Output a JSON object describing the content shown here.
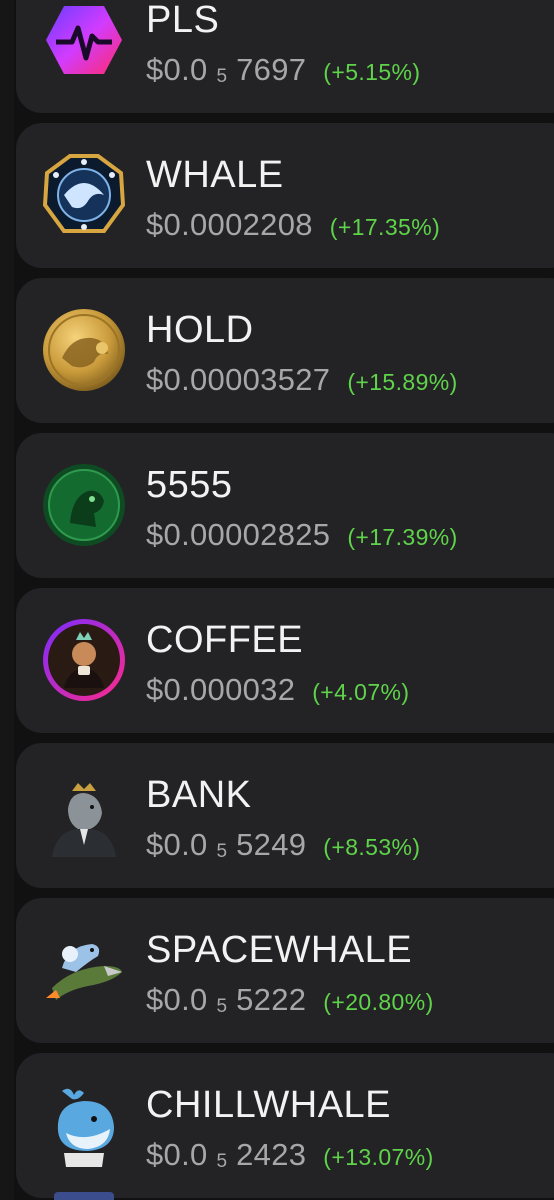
{
  "tokens": [
    {
      "symbol": "PLS",
      "price_prefix": "$0.0",
      "price_zeros": "5",
      "price_digits": "7697",
      "change": "(+5.15%)",
      "logo": "pulse-heartbeat-icon"
    },
    {
      "symbol": "WHALE",
      "price": "$0.0002208",
      "change": "(+17.35%)",
      "logo": "whale-octagon-icon"
    },
    {
      "symbol": "HOLD",
      "price": "$0.00003527",
      "change": "(+15.89%)",
      "logo": "gold-coin-icon"
    },
    {
      "symbol": "5555",
      "price": "$0.00002825",
      "change": "(+17.39%)",
      "logo": "green-coin-icon"
    },
    {
      "symbol": "COFFEE",
      "price": "$0.000032",
      "change": "(+4.07%)",
      "logo": "coffee-avatar-icon"
    },
    {
      "symbol": "BANK",
      "price_prefix": "$0.0",
      "price_zeros": "5",
      "price_digits": "5249",
      "change": "(+8.53%)",
      "logo": "banker-whale-icon"
    },
    {
      "symbol": "SPACEWHALE",
      "price_prefix": "$0.0",
      "price_zeros": "5",
      "price_digits": "5222",
      "change": "(+20.80%)",
      "logo": "rocket-whale-icon"
    },
    {
      "symbol": "CHILLWHALE",
      "price_prefix": "$0.0",
      "price_zeros": "5",
      "price_digits": "2423",
      "change": "(+13.07%)",
      "logo": "cartoon-whale-icon"
    }
  ],
  "colors": {
    "background": "#111112",
    "card": "#232325",
    "symbol_text": "#f2f2f2",
    "price_text": "#a7a7ab",
    "positive_change": "#5fd34a"
  }
}
